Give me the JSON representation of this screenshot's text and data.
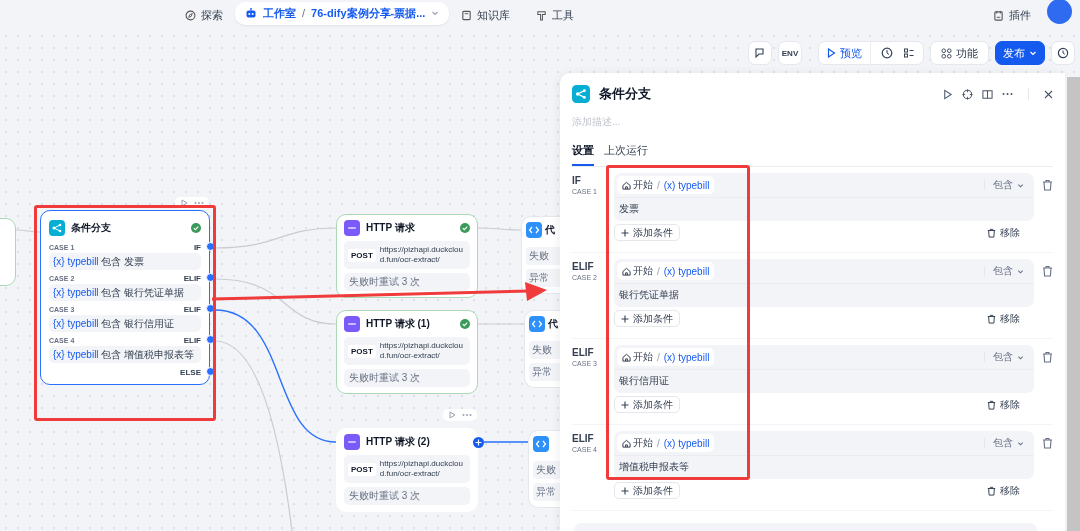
{
  "nav": {
    "explore": "探索",
    "studio": "工作室",
    "separator": "/",
    "app_name": "76-dify案例分享-票据...",
    "knowledge": "知识库",
    "tools": "工具",
    "plugins": "插件"
  },
  "toolbar": {
    "env": "ENV",
    "preview": "预览",
    "features": "功能",
    "publish": "发布"
  },
  "canvas": {
    "if_node": {
      "title": "条件分支",
      "succeeded": true,
      "selected": true,
      "cases": [
        {
          "case": "CASE 1",
          "branch": "IF",
          "var_mark": "{x}",
          "variable": "typebill",
          "operator": "包含",
          "value": "发票"
        },
        {
          "case": "CASE 2",
          "branch": "ELIF",
          "var_mark": "{x}",
          "variable": "typebill",
          "operator": "包含",
          "value": "银行凭证单据"
        },
        {
          "case": "CASE 3",
          "branch": "ELIF",
          "var_mark": "{x}",
          "variable": "typebill",
          "operator": "包含",
          "value": "银行信用证"
        },
        {
          "case": "CASE 4",
          "branch": "ELIF",
          "var_mark": "{x}",
          "variable": "typebill",
          "operator": "包含",
          "value": "增值税申报表等"
        }
      ],
      "else": "ELSE"
    },
    "http_nodes": [
      {
        "title": "HTTP 请求",
        "method": "POST",
        "url": "https://pizhapi.duckcloud.fun/ocr-extract/",
        "retry": "失败时重试 3 次",
        "succeeded": true,
        "hovered": false
      },
      {
        "title": "HTTP 请求 (1)",
        "method": "POST",
        "url": "https://pizhapi.duckcloud.fun/ocr-extract/",
        "retry": "失败时重试 3 次",
        "succeeded": true,
        "hovered": false
      },
      {
        "title": "HTTP 请求 (2)",
        "method": "POST",
        "url": "https://pizhapi.duckcloud.fun/ocr-extract/",
        "retry": "失败时重试 3 次",
        "succeeded": false,
        "hovered": true
      }
    ],
    "code_nodes": [
      {
        "title": "代",
        "lines": [
          "失败",
          "异常"
        ]
      },
      {
        "title": "代",
        "lines": [
          "失败",
          "异常"
        ]
      },
      {
        "lines": [
          "失败",
          "异常"
        ]
      }
    ]
  },
  "panel": {
    "title": "条件分支",
    "description_placeholder": "添加描述...",
    "tabs": [
      {
        "label": "设置",
        "selected": true
      },
      {
        "label": "上次运行",
        "selected": false
      }
    ],
    "cases": [
      {
        "branch": "IF",
        "case": "CASE 1",
        "source": "开始",
        "separator": "/",
        "var_mark": "(x)",
        "variable": "typebill",
        "operator": "包含",
        "value": "发票",
        "add_label": "添加条件",
        "remove_label": "移除"
      },
      {
        "branch": "ELIF",
        "case": "CASE 2",
        "source": "开始",
        "separator": "/",
        "var_mark": "(x)",
        "variable": "typebill",
        "operator": "包含",
        "value": "银行凭证单据",
        "add_label": "添加条件",
        "remove_label": "移除"
      },
      {
        "branch": "ELIF",
        "case": "CASE 3",
        "source": "开始",
        "separator": "/",
        "var_mark": "(x)",
        "variable": "typebill",
        "operator": "包含",
        "value": "银行信用证",
        "add_label": "添加条件",
        "remove_label": "移除"
      },
      {
        "branch": "ELIF",
        "case": "CASE 4",
        "source": "开始",
        "separator": "/",
        "var_mark": "(x)",
        "variable": "typebill",
        "operator": "包含",
        "value": "增值税申报表等",
        "add_label": "添加条件",
        "remove_label": "移除"
      }
    ]
  }
}
